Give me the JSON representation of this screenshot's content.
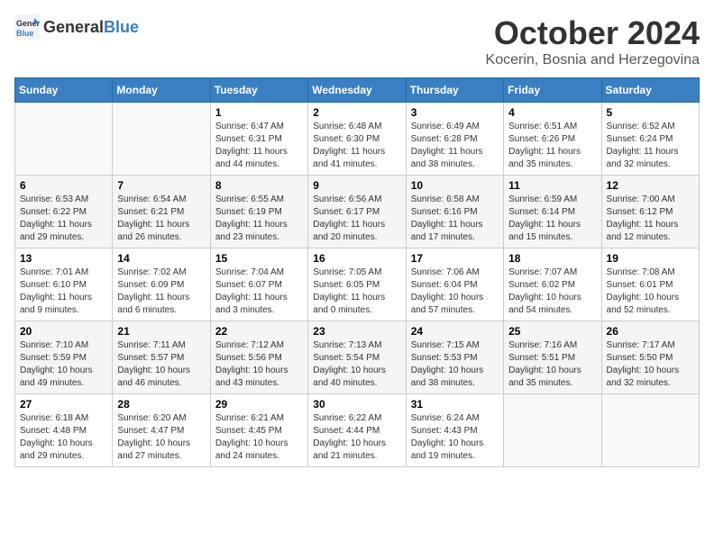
{
  "logo": {
    "general": "General",
    "blue": "Blue"
  },
  "header": {
    "month": "October 2024",
    "location": "Kocerin, Bosnia and Herzegovina"
  },
  "weekdays": [
    "Sunday",
    "Monday",
    "Tuesday",
    "Wednesday",
    "Thursday",
    "Friday",
    "Saturday"
  ],
  "weeks": [
    [
      {
        "day": "",
        "sunrise": "",
        "sunset": "",
        "daylight": ""
      },
      {
        "day": "",
        "sunrise": "",
        "sunset": "",
        "daylight": ""
      },
      {
        "day": "1",
        "sunrise": "Sunrise: 6:47 AM",
        "sunset": "Sunset: 6:31 PM",
        "daylight": "Daylight: 11 hours and 44 minutes."
      },
      {
        "day": "2",
        "sunrise": "Sunrise: 6:48 AM",
        "sunset": "Sunset: 6:30 PM",
        "daylight": "Daylight: 11 hours and 41 minutes."
      },
      {
        "day": "3",
        "sunrise": "Sunrise: 6:49 AM",
        "sunset": "Sunset: 6:28 PM",
        "daylight": "Daylight: 11 hours and 38 minutes."
      },
      {
        "day": "4",
        "sunrise": "Sunrise: 6:51 AM",
        "sunset": "Sunset: 6:26 PM",
        "daylight": "Daylight: 11 hours and 35 minutes."
      },
      {
        "day": "5",
        "sunrise": "Sunrise: 6:52 AM",
        "sunset": "Sunset: 6:24 PM",
        "daylight": "Daylight: 11 hours and 32 minutes."
      }
    ],
    [
      {
        "day": "6",
        "sunrise": "Sunrise: 6:53 AM",
        "sunset": "Sunset: 6:22 PM",
        "daylight": "Daylight: 11 hours and 29 minutes."
      },
      {
        "day": "7",
        "sunrise": "Sunrise: 6:54 AM",
        "sunset": "Sunset: 6:21 PM",
        "daylight": "Daylight: 11 hours and 26 minutes."
      },
      {
        "day": "8",
        "sunrise": "Sunrise: 6:55 AM",
        "sunset": "Sunset: 6:19 PM",
        "daylight": "Daylight: 11 hours and 23 minutes."
      },
      {
        "day": "9",
        "sunrise": "Sunrise: 6:56 AM",
        "sunset": "Sunset: 6:17 PM",
        "daylight": "Daylight: 11 hours and 20 minutes."
      },
      {
        "day": "10",
        "sunrise": "Sunrise: 6:58 AM",
        "sunset": "Sunset: 6:16 PM",
        "daylight": "Daylight: 11 hours and 17 minutes."
      },
      {
        "day": "11",
        "sunrise": "Sunrise: 6:59 AM",
        "sunset": "Sunset: 6:14 PM",
        "daylight": "Daylight: 11 hours and 15 minutes."
      },
      {
        "day": "12",
        "sunrise": "Sunrise: 7:00 AM",
        "sunset": "Sunset: 6:12 PM",
        "daylight": "Daylight: 11 hours and 12 minutes."
      }
    ],
    [
      {
        "day": "13",
        "sunrise": "Sunrise: 7:01 AM",
        "sunset": "Sunset: 6:10 PM",
        "daylight": "Daylight: 11 hours and 9 minutes."
      },
      {
        "day": "14",
        "sunrise": "Sunrise: 7:02 AM",
        "sunset": "Sunset: 6:09 PM",
        "daylight": "Daylight: 11 hours and 6 minutes."
      },
      {
        "day": "15",
        "sunrise": "Sunrise: 7:04 AM",
        "sunset": "Sunset: 6:07 PM",
        "daylight": "Daylight: 11 hours and 3 minutes."
      },
      {
        "day": "16",
        "sunrise": "Sunrise: 7:05 AM",
        "sunset": "Sunset: 6:05 PM",
        "daylight": "Daylight: 11 hours and 0 minutes."
      },
      {
        "day": "17",
        "sunrise": "Sunrise: 7:06 AM",
        "sunset": "Sunset: 6:04 PM",
        "daylight": "Daylight: 10 hours and 57 minutes."
      },
      {
        "day": "18",
        "sunrise": "Sunrise: 7:07 AM",
        "sunset": "Sunset: 6:02 PM",
        "daylight": "Daylight: 10 hours and 54 minutes."
      },
      {
        "day": "19",
        "sunrise": "Sunrise: 7:08 AM",
        "sunset": "Sunset: 6:01 PM",
        "daylight": "Daylight: 10 hours and 52 minutes."
      }
    ],
    [
      {
        "day": "20",
        "sunrise": "Sunrise: 7:10 AM",
        "sunset": "Sunset: 5:59 PM",
        "daylight": "Daylight: 10 hours and 49 minutes."
      },
      {
        "day": "21",
        "sunrise": "Sunrise: 7:11 AM",
        "sunset": "Sunset: 5:57 PM",
        "daylight": "Daylight: 10 hours and 46 minutes."
      },
      {
        "day": "22",
        "sunrise": "Sunrise: 7:12 AM",
        "sunset": "Sunset: 5:56 PM",
        "daylight": "Daylight: 10 hours and 43 minutes."
      },
      {
        "day": "23",
        "sunrise": "Sunrise: 7:13 AM",
        "sunset": "Sunset: 5:54 PM",
        "daylight": "Daylight: 10 hours and 40 minutes."
      },
      {
        "day": "24",
        "sunrise": "Sunrise: 7:15 AM",
        "sunset": "Sunset: 5:53 PM",
        "daylight": "Daylight: 10 hours and 38 minutes."
      },
      {
        "day": "25",
        "sunrise": "Sunrise: 7:16 AM",
        "sunset": "Sunset: 5:51 PM",
        "daylight": "Daylight: 10 hours and 35 minutes."
      },
      {
        "day": "26",
        "sunrise": "Sunrise: 7:17 AM",
        "sunset": "Sunset: 5:50 PM",
        "daylight": "Daylight: 10 hours and 32 minutes."
      }
    ],
    [
      {
        "day": "27",
        "sunrise": "Sunrise: 6:18 AM",
        "sunset": "Sunset: 4:48 PM",
        "daylight": "Daylight: 10 hours and 29 minutes."
      },
      {
        "day": "28",
        "sunrise": "Sunrise: 6:20 AM",
        "sunset": "Sunset: 4:47 PM",
        "daylight": "Daylight: 10 hours and 27 minutes."
      },
      {
        "day": "29",
        "sunrise": "Sunrise: 6:21 AM",
        "sunset": "Sunset: 4:45 PM",
        "daylight": "Daylight: 10 hours and 24 minutes."
      },
      {
        "day": "30",
        "sunrise": "Sunrise: 6:22 AM",
        "sunset": "Sunset: 4:44 PM",
        "daylight": "Daylight: 10 hours and 21 minutes."
      },
      {
        "day": "31",
        "sunrise": "Sunrise: 6:24 AM",
        "sunset": "Sunset: 4:43 PM",
        "daylight": "Daylight: 10 hours and 19 minutes."
      },
      {
        "day": "",
        "sunrise": "",
        "sunset": "",
        "daylight": ""
      },
      {
        "day": "",
        "sunrise": "",
        "sunset": "",
        "daylight": ""
      }
    ]
  ]
}
